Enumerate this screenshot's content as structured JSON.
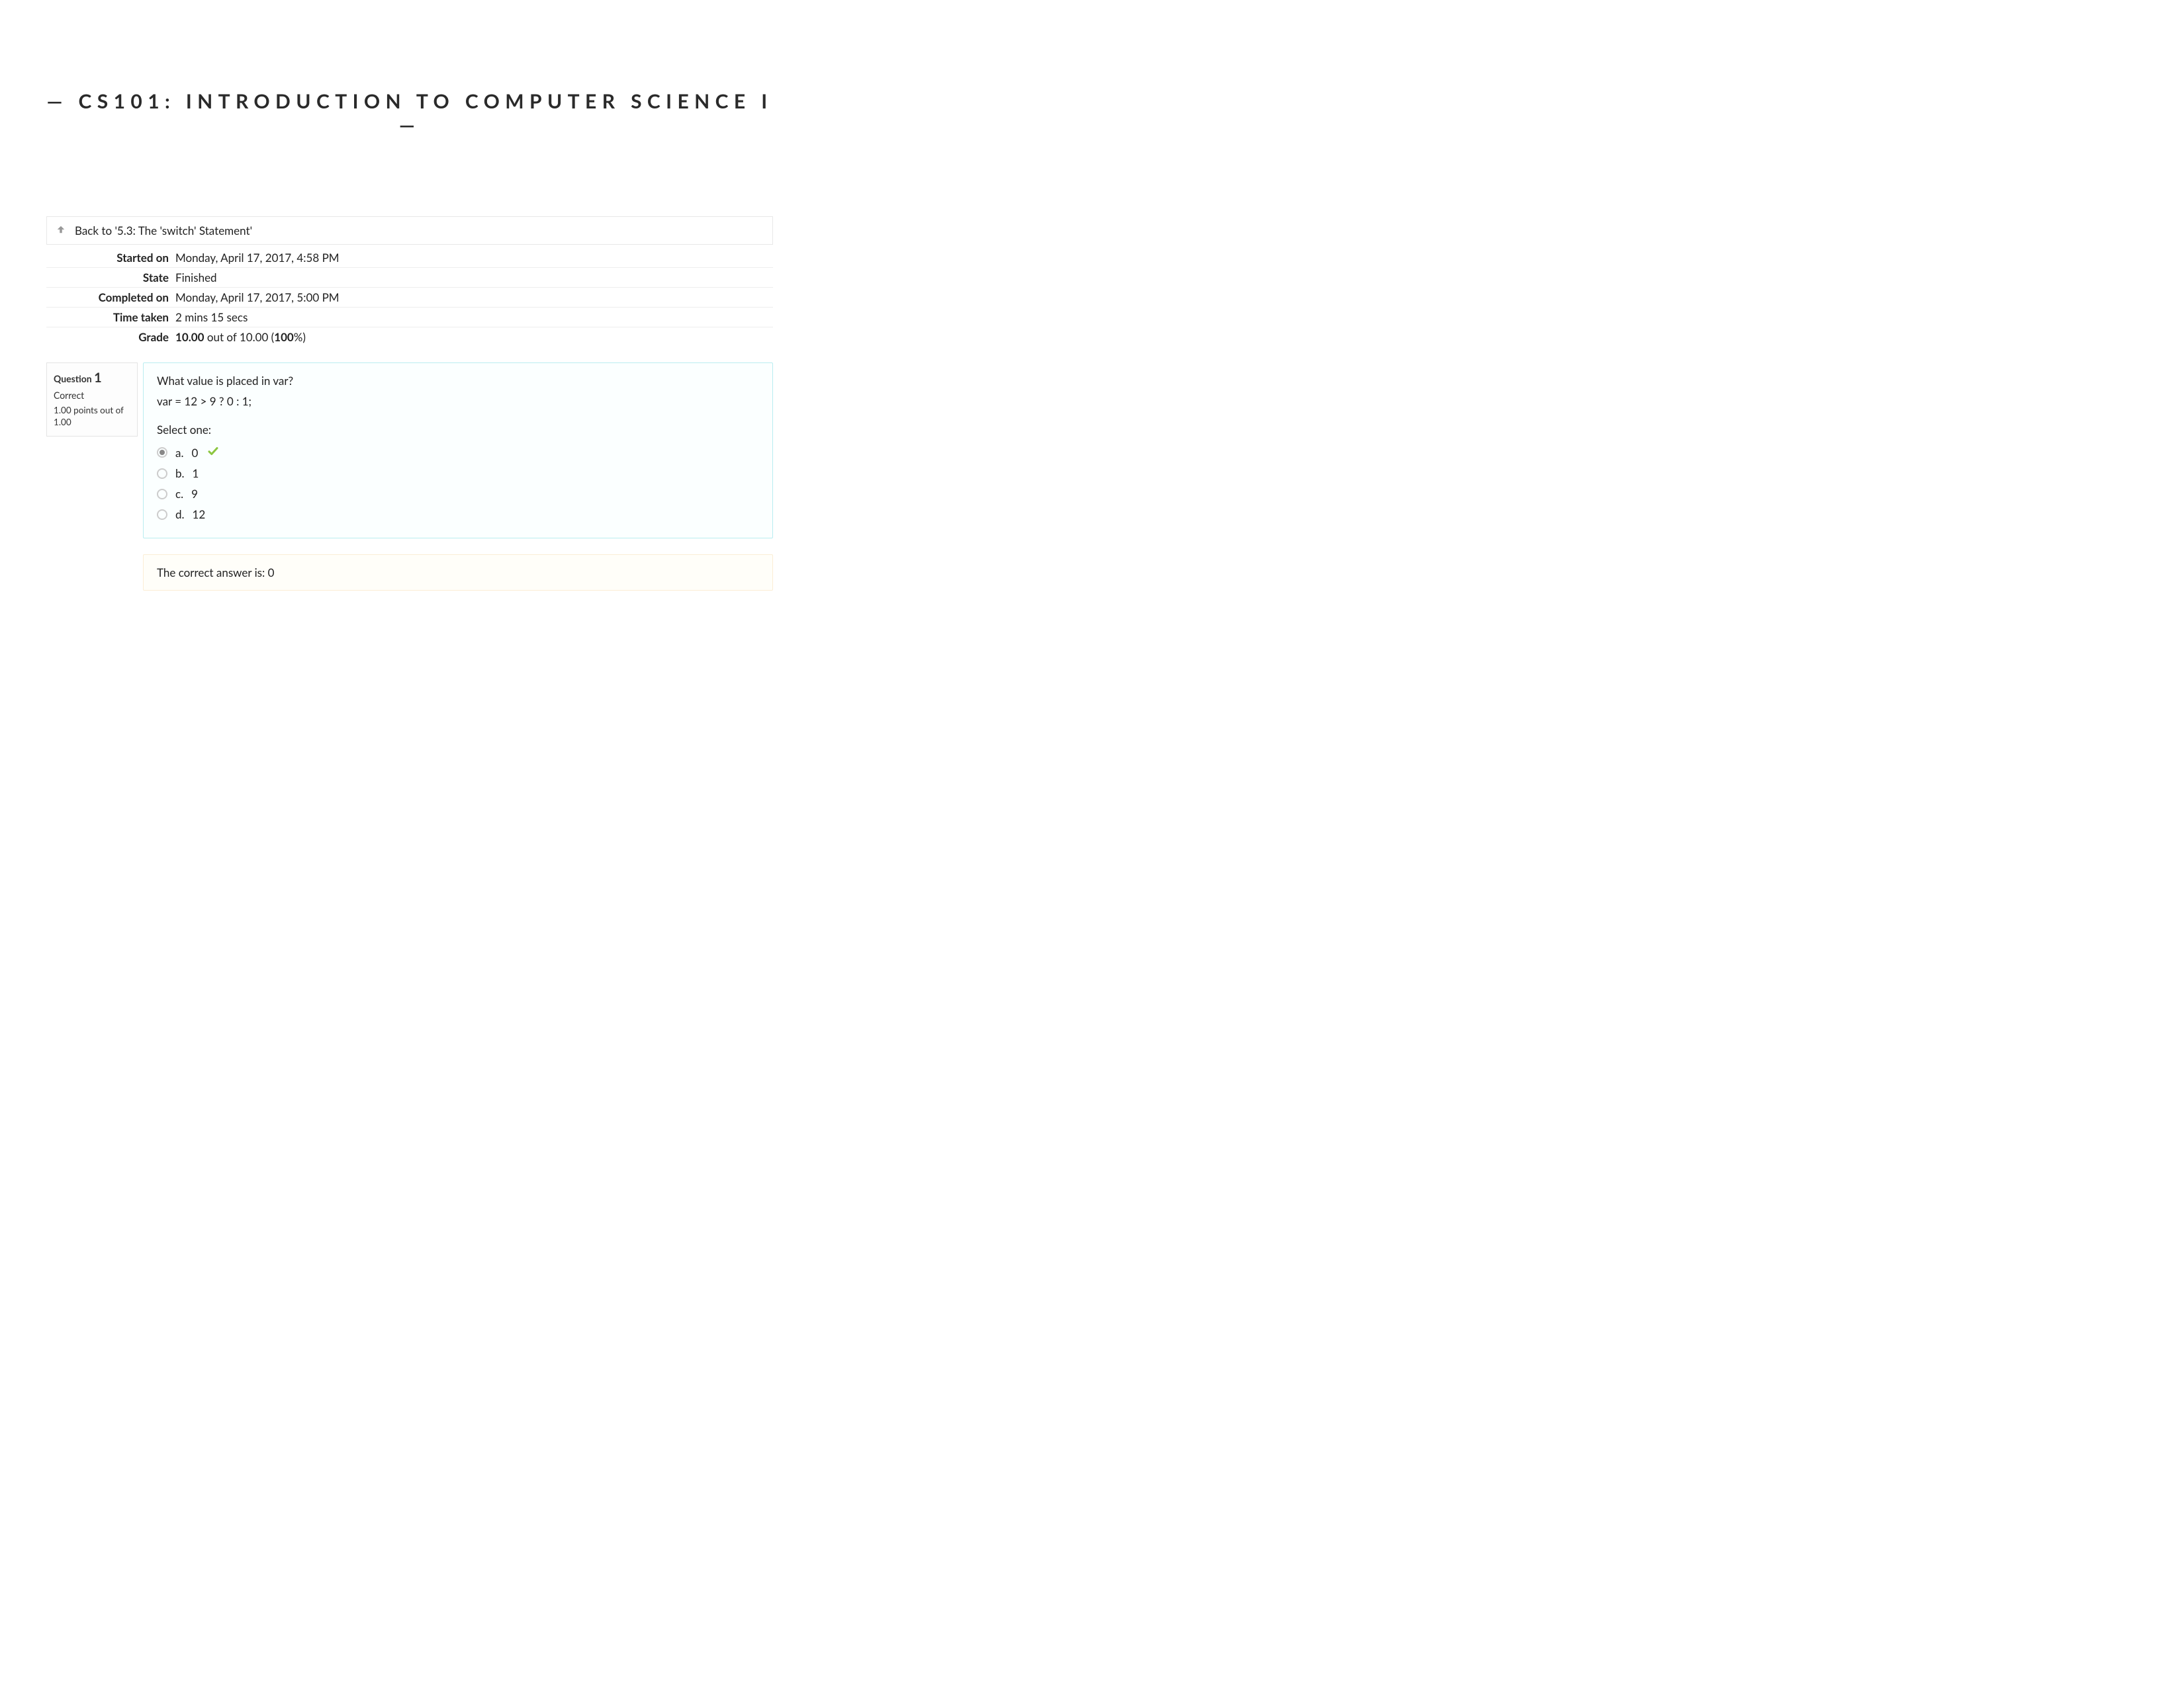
{
  "title": "— CS101: INTRODUCTION TO COMPUTER SCIENCE I —",
  "back": {
    "label": "Back to '5.3: The 'switch' Statement'"
  },
  "meta": {
    "started_on_label": "Started on",
    "started_on": "Monday, April 17, 2017, 4:58 PM",
    "state_label": "State",
    "state": "Finished",
    "completed_on_label": "Completed on",
    "completed_on": "Monday, April 17, 2017, 5:00 PM",
    "time_taken_label": "Time taken",
    "time_taken": "2 mins 15 secs",
    "grade_label": "Grade",
    "grade_earned": "10.00",
    "grade_out_of_text": " out of 10.00 (",
    "grade_percent": "100",
    "grade_percent_suffix": "%)"
  },
  "question": {
    "label": "Question",
    "number": "1",
    "status": "Correct",
    "points_text": "1.00 points out of 1.00",
    "prompt": "What value is placed in var?",
    "code": "var = 12 > 9 ? 0 : 1;",
    "select_one": "Select one:",
    "options": [
      {
        "letter": "a.",
        "text": "0",
        "selected": true,
        "correct": true
      },
      {
        "letter": "b.",
        "text": "1",
        "selected": false,
        "correct": false
      },
      {
        "letter": "c.",
        "text": "9",
        "selected": false,
        "correct": false
      },
      {
        "letter": "d.",
        "text": "12",
        "selected": false,
        "correct": false
      }
    ],
    "feedback": "The correct answer is: 0"
  }
}
